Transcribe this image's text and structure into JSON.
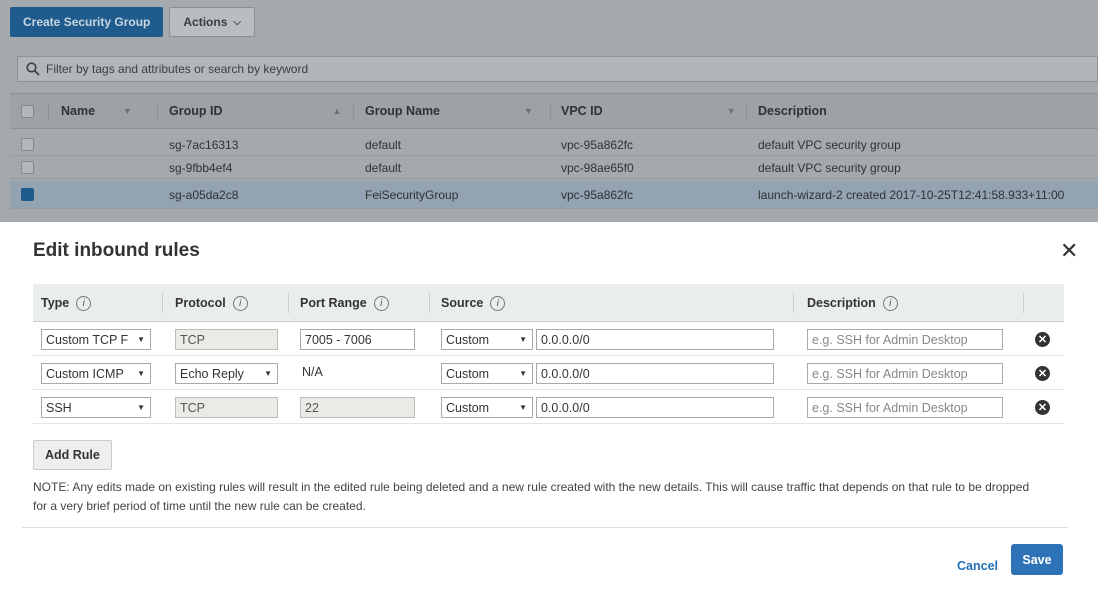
{
  "console": {
    "create_button": "Create Security Group",
    "actions_button": "Actions",
    "filter_placeholder": "Filter by tags and attributes or search by keyword",
    "columns": [
      "Name",
      "Group ID",
      "Group Name",
      "VPC ID",
      "Description"
    ],
    "rows": [
      {
        "name": "",
        "group_id": "sg-7ac16313",
        "group_name": "default",
        "vpc_id": "vpc-95a862fc",
        "description": "default VPC security group",
        "selected": false
      },
      {
        "name": "",
        "group_id": "sg-9fbb4ef4",
        "group_name": "default",
        "vpc_id": "vpc-98ae65f0",
        "description": "default VPC security group",
        "selected": false
      },
      {
        "name": "",
        "group_id": "sg-a05da2c8",
        "group_name": "FeiSecurityGroup",
        "vpc_id": "vpc-95a862fc",
        "description": "launch-wizard-2 created 2017-10-25T12:41:58.933+11:00",
        "selected": true
      }
    ]
  },
  "modal": {
    "title": "Edit inbound rules",
    "columns": {
      "type": "Type",
      "protocol": "Protocol",
      "port_range": "Port Range",
      "source": "Source",
      "description": "Description"
    },
    "info_glyph": "i",
    "rules": [
      {
        "type": "Custom TCP F",
        "protocol": "TCP",
        "port_range": "7005 - 7006",
        "source_type": "Custom",
        "source_cidr": "0.0.0.0/0",
        "description_placeholder": "e.g. SSH for Admin Desktop"
      },
      {
        "type": "Custom ICMP",
        "protocol": "Echo Reply",
        "port_range": "N/A",
        "source_type": "Custom",
        "source_cidr": "0.0.0.0/0",
        "description_placeholder": "e.g. SSH for Admin Desktop"
      },
      {
        "type": "SSH",
        "protocol": "TCP",
        "port_range": "22",
        "source_type": "Custom",
        "source_cidr": "0.0.0.0/0",
        "description_placeholder": "e.g. SSH for Admin Desktop"
      }
    ],
    "add_rule_label": "Add Rule",
    "note": "NOTE: Any edits made on existing rules will result in the edited rule being deleted and a new rule created with the new details. This will cause traffic that depends on that rule to be dropped for a very brief period of time until the new rule can be created.",
    "cancel_label": "Cancel",
    "save_label": "Save"
  },
  "colors": {
    "primary": "#2e73b8",
    "link": "#1f6fb5",
    "overlay": "#a4a9ad"
  }
}
